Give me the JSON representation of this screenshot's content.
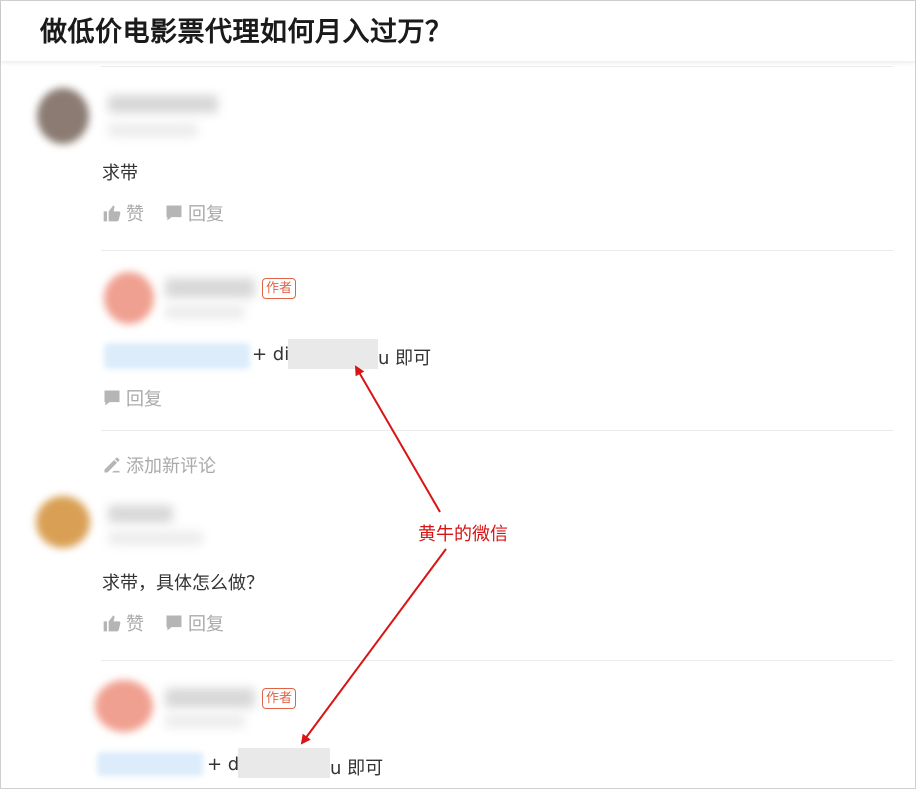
{
  "page": {
    "title": "做低价电影票代理如何月入过万？"
  },
  "comments": [
    {
      "text": "求带",
      "like_label": "赞",
      "reply_label": "回复"
    },
    {
      "text": "求带，具体怎么做？",
      "like_label": "赞",
      "reply_label": "回复"
    }
  ],
  "replies": [
    {
      "badge": "作者",
      "prefix": "+ di",
      "suffix": "u 即可",
      "reply_label": "回复"
    },
    {
      "badge": "作者",
      "prefix": "+ d",
      "suffix": "u 即可"
    }
  ],
  "add_comment": {
    "label": "添加新评论"
  },
  "annotation": {
    "text": "黄牛的微信",
    "color": "#d81414"
  },
  "icons": {
    "like": "thumbs-up-icon",
    "reply": "speech-bubble-icon",
    "edit": "pencil-icon"
  }
}
